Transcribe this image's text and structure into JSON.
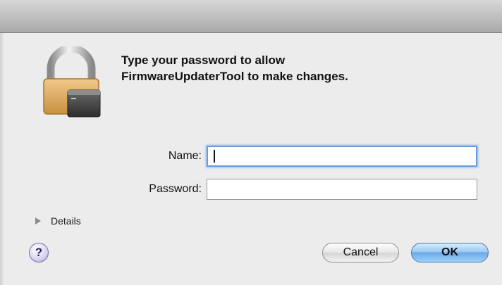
{
  "dialog": {
    "icon": "lock-icon",
    "message_line1": "Type your password to allow",
    "message_line2": "FirmwareUpdaterTool to make changes."
  },
  "form": {
    "name_label": "Name:",
    "name_value": "",
    "password_label": "Password:",
    "password_value": ""
  },
  "details": {
    "label": "Details",
    "icon": "disclosure-triangle-icon"
  },
  "help": {
    "label": "?"
  },
  "buttons": {
    "cancel": "Cancel",
    "ok": "OK"
  },
  "colors": {
    "focus_ring": "#6a9cd8",
    "default_button": "#6aa9e6"
  }
}
